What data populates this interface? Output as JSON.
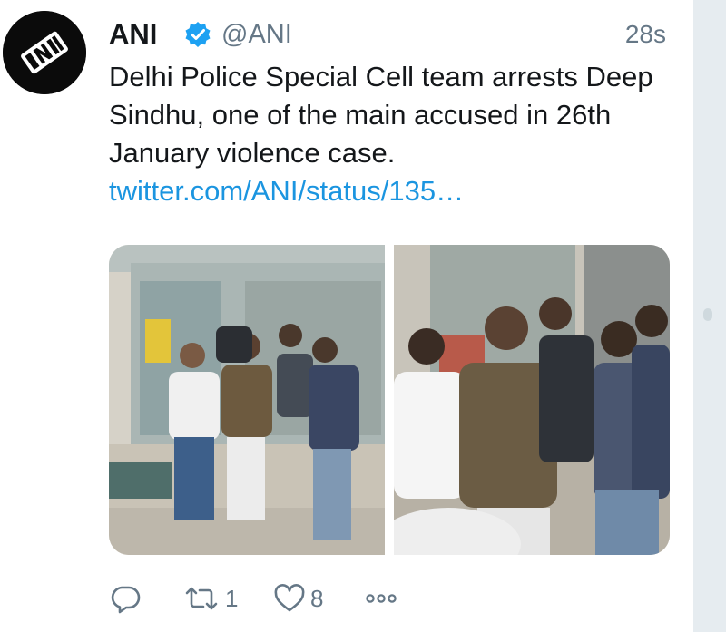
{
  "tweet": {
    "author_name": "ANI",
    "author_handle": "@ANI",
    "timestamp": "28s",
    "avatar_logo_text": "ANI",
    "text_main": "Delhi Police Special Cell team arrests Deep Sindhu, one of the main accused in 26th January violence case. ",
    "text_link": "twitter.com/ANI/status/135…",
    "retweet_count": "1",
    "like_count": "8"
  },
  "icons": {
    "reply": "reply-icon",
    "retweet": "retweet-icon",
    "like": "heart-icon",
    "more": "more-icon",
    "verified": "verified-badge-icon"
  },
  "colors": {
    "link": "#1b95e0",
    "verified": "#1da1f2",
    "muted": "#657786",
    "sidebar": "#e6ecf0"
  }
}
